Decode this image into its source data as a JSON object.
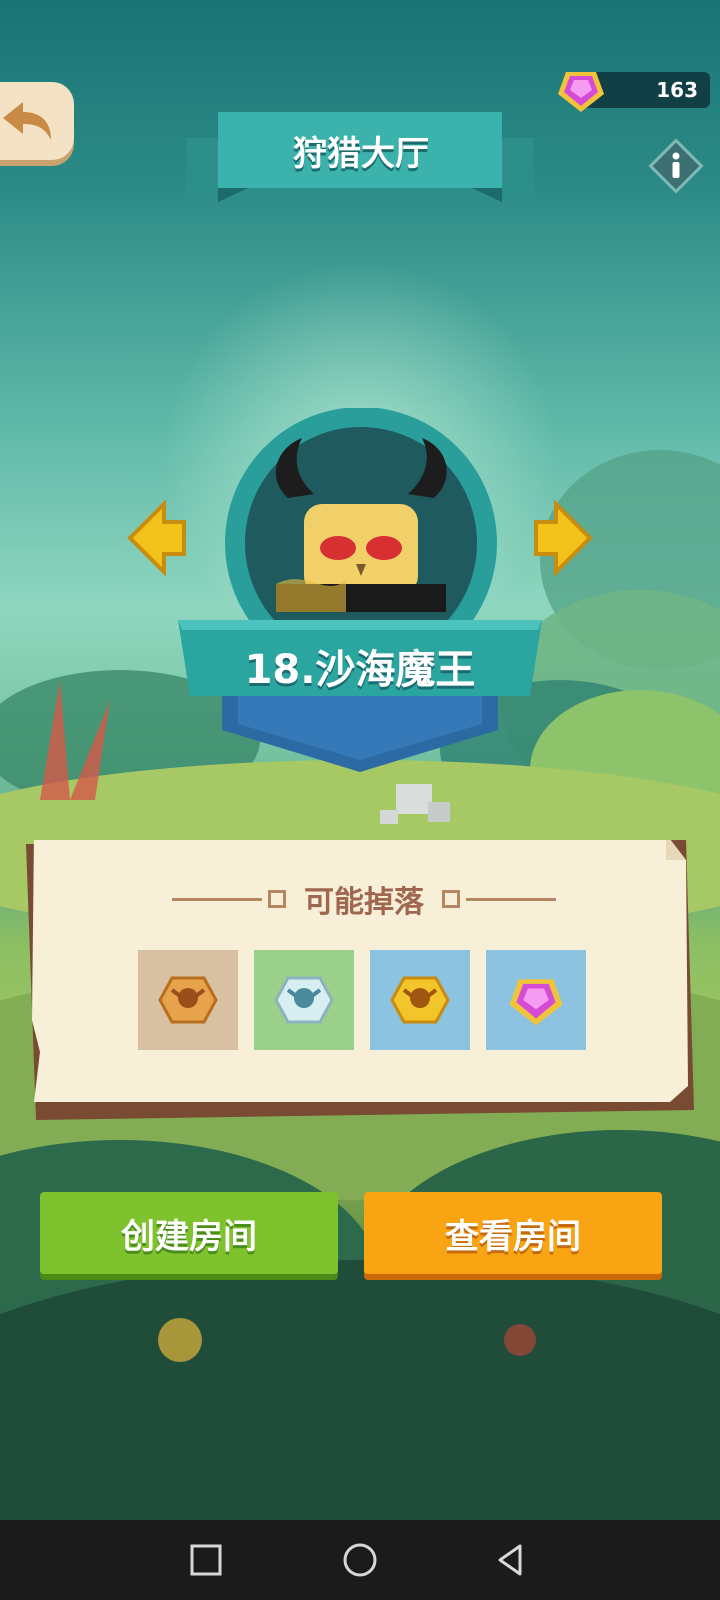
{
  "header": {
    "title": "狩猎大厅",
    "gem_count": "163"
  },
  "boss": {
    "name": "18.沙海魔王"
  },
  "drops": {
    "title": "可能掉落",
    "items": [
      {
        "icon": "bronze-skull-medal-icon",
        "bg": "#d8c1a3"
      },
      {
        "icon": "silver-skull-medal-icon",
        "bg": "#9bd08a"
      },
      {
        "icon": "gold-skull-medal-icon",
        "bg": "#8cc3e0"
      },
      {
        "icon": "purple-gem-icon",
        "bg": "#8cc3e0"
      }
    ]
  },
  "buttons": {
    "create": "创建房间",
    "view": "查看房间"
  },
  "colors": {
    "accent_green": "#7ec32d",
    "accent_orange": "#f9a412",
    "ribbon_teal": "#2aa5a0"
  }
}
